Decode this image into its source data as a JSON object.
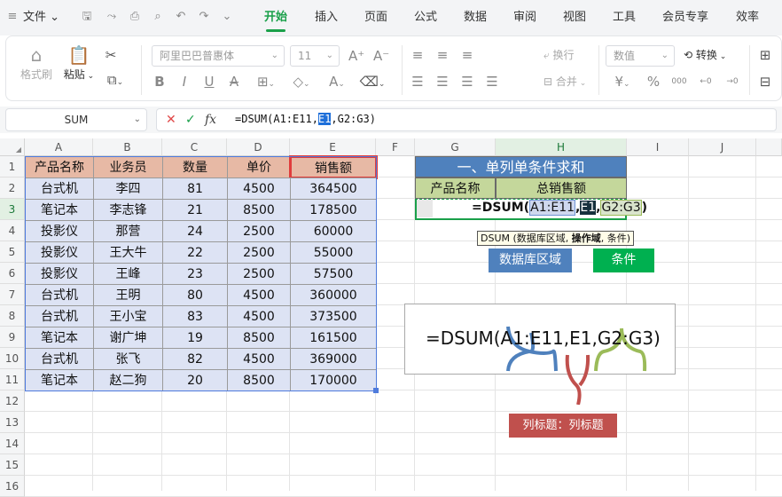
{
  "menubar": {
    "file_label": "文件",
    "tabs": [
      {
        "label": "开始",
        "active": true
      },
      {
        "label": "插入"
      },
      {
        "label": "页面"
      },
      {
        "label": "公式"
      },
      {
        "label": "数据"
      },
      {
        "label": "审阅"
      },
      {
        "label": "视图"
      },
      {
        "label": "工具"
      },
      {
        "label": "会员专享"
      },
      {
        "label": "效率"
      }
    ]
  },
  "ribbon": {
    "format_painter": "格式刷",
    "paste": "粘贴",
    "font_name": "阿里巴巴普惠体",
    "font_size": "11",
    "wrap": "换行",
    "merge": "合并",
    "number_format": "数值",
    "convert": "转换",
    "currency_symbol": "¥",
    "percent_symbol": "%"
  },
  "formula_bar": {
    "name_box": "SUM",
    "fx_label": "fx",
    "formula_before": "=DSUM(A1:E11,",
    "formula_highlight": "E1",
    "formula_after": ",G2:G3)"
  },
  "columns": [
    "A",
    "B",
    "C",
    "D",
    "E",
    "F",
    "G",
    "H",
    "I",
    "J"
  ],
  "rows": [
    "1",
    "2",
    "3",
    "4",
    "5",
    "6",
    "7",
    "8",
    "9",
    "10",
    "11",
    "12",
    "13",
    "14",
    "15",
    "16"
  ],
  "table": {
    "headers": [
      "产品名称",
      "业务员",
      "数量",
      "单价",
      "销售额"
    ],
    "rows": [
      [
        "台式机",
        "李四",
        "81",
        "4500",
        "364500"
      ],
      [
        "笔记本",
        "李志锋",
        "21",
        "8500",
        "178500"
      ],
      [
        "投影仪",
        "那营",
        "24",
        "2500",
        "60000"
      ],
      [
        "投影仪",
        "王大牛",
        "22",
        "2500",
        "55000"
      ],
      [
        "投影仪",
        "王峰",
        "23",
        "2500",
        "57500"
      ],
      [
        "台式机",
        "王明",
        "80",
        "4500",
        "360000"
      ],
      [
        "台式机",
        "王小宝",
        "83",
        "4500",
        "373500"
      ],
      [
        "笔记本",
        "谢广坤",
        "19",
        "8500",
        "161500"
      ],
      [
        "台式机",
        "张飞",
        "82",
        "4500",
        "369000"
      ],
      [
        "笔记本",
        "赵二狗",
        "20",
        "8500",
        "170000"
      ]
    ]
  },
  "right_panel": {
    "title": "一、单列单条件求和",
    "col_g_header": "产品名称",
    "col_h_header": "总销售额",
    "cell_formula_prefix": "=DSUM(",
    "cell_formula_arg1": "A1:E11",
    "cell_formula_arg2": "E1",
    "cell_formula_arg3": "G2:G3",
    "cell_formula_suffix": ")",
    "tooltip_prefix": "DSUM (数据库区域, ",
    "tooltip_bold": "操作域",
    "tooltip_suffix": ", 条件)",
    "label_database": "数据库区域",
    "label_criteria": "条件",
    "big_formula": "=DSUM(A1:E11,E1,G2:G3)",
    "label_field": "列标题：列标题"
  },
  "colors": {
    "accent_green": "#1aa04a",
    "header_fill": "#e7b9a5",
    "body_fill": "#dde3f4",
    "title_fill": "#4f81bd",
    "subheader_fill": "#c4d79b",
    "label_blue": "#4f81bd",
    "label_green": "#00b050",
    "label_red": "#c0504d",
    "brace_blue": "#4f81bd",
    "brace_green": "#9bbb59",
    "brace_red": "#c0504d"
  }
}
